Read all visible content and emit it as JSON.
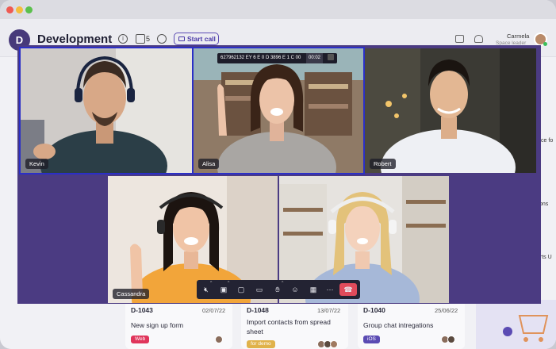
{
  "app": {
    "workspace_initial": "D",
    "workspace_title": "Development",
    "member_count": "5",
    "start_call_label": "Start call",
    "user_name": "Carmela",
    "user_role": "Space leader"
  },
  "board": {
    "cards": [
      {
        "id": "D-1043",
        "date": "02/07/22",
        "title": "New sign up form",
        "tag": "Web",
        "tag_color": "#e0355b"
      },
      {
        "id": "D-1048",
        "date": "13/07/22",
        "title": "Import contacts from spread sheet",
        "tag": "for demo",
        "tag_color": "#e0b24a"
      },
      {
        "id": "D-1040",
        "date": "25/06/22",
        "title": "Group chat intregations",
        "tag": "iOS",
        "tag_color": "#5b4bb3"
      }
    ],
    "side_snippets": [
      "vice fo",
      "ons",
      "orts U"
    ]
  },
  "call": {
    "meeting_id": "627962132 EY 6 E 0 D 3896 E 1 C 00",
    "timer": "00:02",
    "participants": [
      {
        "name": "Kevin"
      },
      {
        "name": "Alisa"
      },
      {
        "name": "Robert"
      },
      {
        "name": "Cassandra"
      },
      {
        "name": ""
      }
    ],
    "controls": [
      "mute-mic",
      "stop-video",
      "share-screen",
      "chat",
      "raise-hand",
      "reactions",
      "layout",
      "more",
      "end-call"
    ]
  }
}
